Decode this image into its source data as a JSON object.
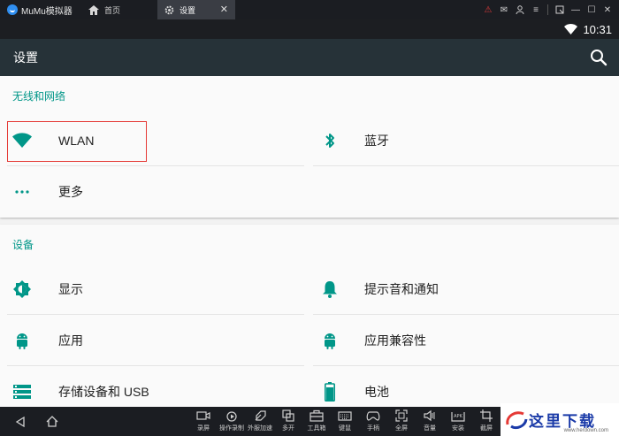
{
  "window": {
    "app_name": "MuMu模拟器",
    "tabs": [
      {
        "label": "首页"
      },
      {
        "label": "设置"
      }
    ]
  },
  "statusbar": {
    "time": "10:31"
  },
  "actionbar": {
    "title": "设置"
  },
  "sections": [
    {
      "title": "无线和网络",
      "items": [
        {
          "label": "WLAN",
          "icon": "wifi-icon"
        },
        {
          "label": "蓝牙",
          "icon": "bluetooth-icon"
        },
        {
          "label": "更多",
          "icon": "more-dots-icon"
        }
      ]
    },
    {
      "title": "设备",
      "items": [
        {
          "label": "显示",
          "icon": "brightness-icon"
        },
        {
          "label": "提示音和通知",
          "icon": "bell-icon"
        },
        {
          "label": "应用",
          "icon": "android-icon"
        },
        {
          "label": "应用兼容性",
          "icon": "android-icon"
        },
        {
          "label": "存储设备和 USB",
          "icon": "storage-icon"
        },
        {
          "label": "电池",
          "icon": "battery-icon"
        }
      ]
    }
  ],
  "toolbar": {
    "items": [
      {
        "label": "录屏",
        "icon": "record-icon"
      },
      {
        "label": "操作录制",
        "icon": "macro-record-icon"
      },
      {
        "label": "外服加速",
        "icon": "accelerate-icon"
      },
      {
        "label": "多开",
        "icon": "multi-instance-icon"
      },
      {
        "label": "工具箱",
        "icon": "toolbox-icon"
      },
      {
        "label": "键鼠",
        "icon": "keyboard-icon"
      },
      {
        "label": "手柄",
        "icon": "gamepad-icon"
      },
      {
        "label": "全屏",
        "icon": "fullscreen-icon"
      },
      {
        "label": "音量",
        "icon": "volume-icon"
      },
      {
        "label": "安装",
        "icon": "apk-install-icon"
      },
      {
        "label": "截屏",
        "icon": "screenshot-icon"
      }
    ]
  },
  "watermark": {
    "text": "这里下载",
    "url": "www.herdown.com"
  },
  "colors": {
    "accent": "#009688",
    "actionbar": "#263238",
    "highlight": "#e53935"
  }
}
